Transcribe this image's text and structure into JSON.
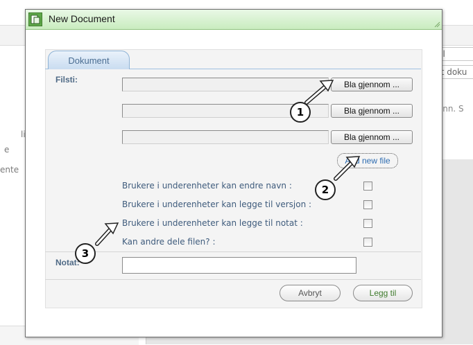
{
  "background": {
    "left_fragments": [
      "lise",
      "e",
      "ente"
    ],
    "right_fields": [
      "fil",
      "tt doku",
      "Ann. S"
    ]
  },
  "dialog": {
    "title": "New Document",
    "tab_label": "Dokument",
    "filsti_label": "Filsti:",
    "browse_buttons": [
      "Bla gjennom ...",
      "Bla gjennom ...",
      "Bla gjennom ..."
    ],
    "add_new_file": "Add new file",
    "permissions": [
      {
        "label": "Brukere i underenheter kan endre navn :",
        "checked": false
      },
      {
        "label": "Brukere i underenheter kan legge til versjon :",
        "checked": false
      },
      {
        "label": "Brukere i underenheter kan legge til notat :",
        "checked": false
      },
      {
        "label": "Kan andre dele filen? :",
        "checked": false
      }
    ],
    "notat_label": "Notat:",
    "notat_value": "",
    "cancel_label": "Avbryt",
    "submit_label": "Legg til"
  },
  "annotations": [
    "1",
    "2",
    "3"
  ],
  "colors": {
    "titlebar": "#c9ecbf",
    "tab_text": "#4a6d92",
    "label_text": "#4f6a86",
    "link": "#2f6db1"
  }
}
